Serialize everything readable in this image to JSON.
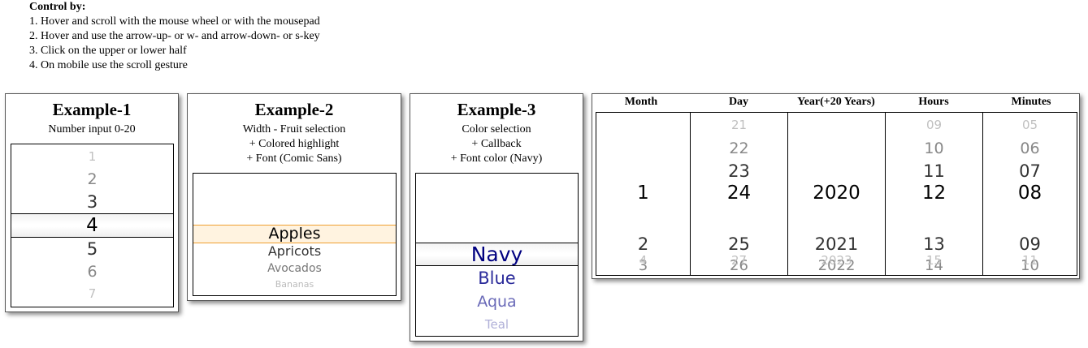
{
  "instructions": {
    "heading": "Control by:",
    "lines": [
      "1. Hover and scroll with the mouse wheel or with the mousepad",
      "2. Hover and use the arrow-up- or w- and arrow-down- or s-key",
      "3. Click on the upper or lower half",
      "4. On mobile use the scroll gesture"
    ]
  },
  "example1": {
    "title": "Example-1",
    "subtitle": "Number input 0-20",
    "items": [
      "1",
      "2",
      "3",
      "4",
      "5",
      "6",
      "7"
    ],
    "selected": "4"
  },
  "example2": {
    "title": "Example-2",
    "subtitle_lines": [
      "Width - Fruit selection",
      "+ Colored highlight",
      "+ Font (Comic Sans)"
    ],
    "items": [
      "Apples",
      "Apricots",
      "Avocados",
      "Bananas"
    ],
    "selected": "Apples",
    "highlight_color": "#f0a030"
  },
  "example3": {
    "title": "Example-3",
    "subtitle_lines": [
      "Color selection",
      "+ Callback",
      "+ Font color (Navy)"
    ],
    "items": [
      "Navy",
      "Blue",
      "Aqua",
      "Teal"
    ],
    "selected": "Navy",
    "font_color": "#000080"
  },
  "datetime": {
    "columns": [
      {
        "header": "Month",
        "items": [
          "",
          "",
          "",
          "1",
          "2",
          "3",
          "4"
        ]
      },
      {
        "header": "Day",
        "items": [
          "21",
          "22",
          "23",
          "24",
          "25",
          "26",
          "27"
        ]
      },
      {
        "header": "Year(+20 Years)",
        "items": [
          "",
          "",
          "",
          "2020",
          "2021",
          "2022",
          "2023"
        ]
      },
      {
        "header": "Hours",
        "items": [
          "09",
          "10",
          "11",
          "12",
          "13",
          "14",
          "15"
        ]
      },
      {
        "header": "Minutes",
        "items": [
          "05",
          "06",
          "07",
          "08",
          "09",
          "10",
          "11"
        ]
      }
    ]
  }
}
